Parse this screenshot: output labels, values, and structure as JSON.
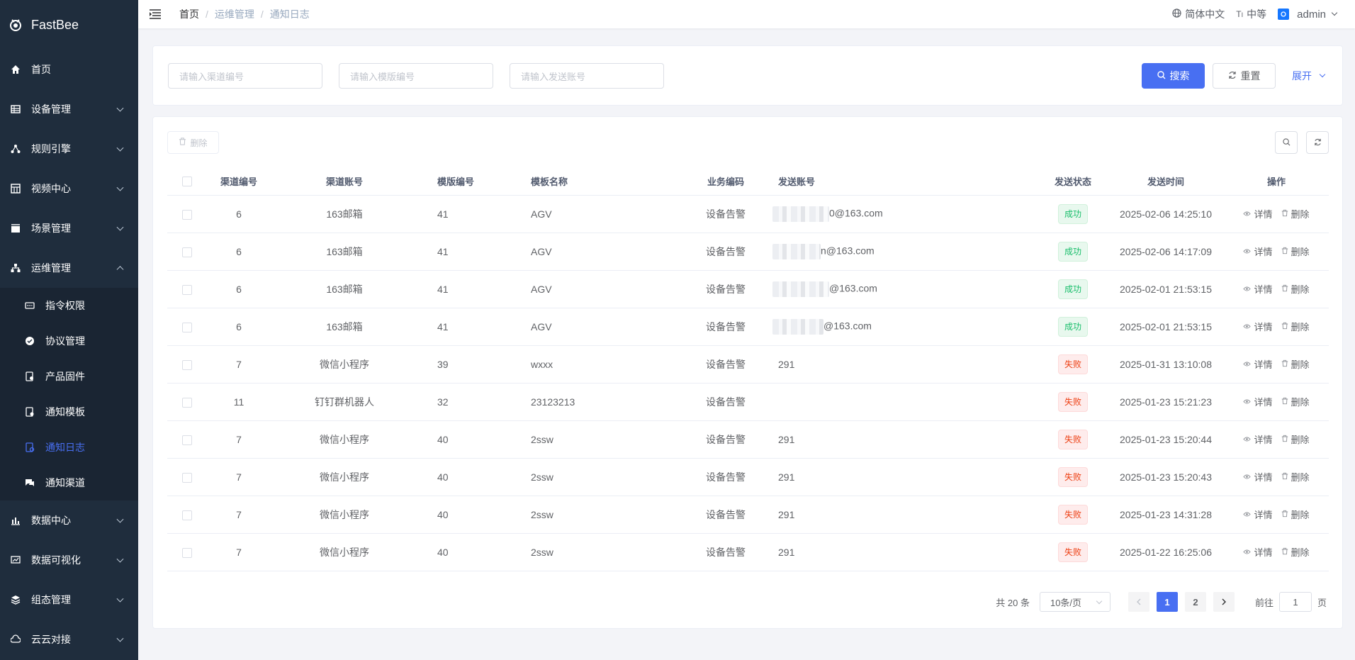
{
  "app": {
    "name": "FastBee"
  },
  "colors": {
    "sidebar_bg": "#1f2d3d",
    "accent": "#486ff2",
    "success": "#19be6b",
    "danger": "#ed4014"
  },
  "sidebar": {
    "items": [
      {
        "label": "首页",
        "icon": "home-icon"
      },
      {
        "label": "设备管理",
        "icon": "device-icon"
      },
      {
        "label": "规则引擎",
        "icon": "rule-icon"
      },
      {
        "label": "视频中心",
        "icon": "video-icon"
      },
      {
        "label": "场景管理",
        "icon": "scene-icon"
      },
      {
        "label": "运维管理",
        "icon": "ops-icon",
        "expanded": true
      },
      {
        "label": "数据中心",
        "icon": "data-center-icon"
      },
      {
        "label": "数据可视化",
        "icon": "visualization-icon"
      },
      {
        "label": "组态管理",
        "icon": "layers-icon"
      },
      {
        "label": "云云对接",
        "icon": "cloud-icon"
      }
    ],
    "ops_children": [
      {
        "label": "指令权限",
        "icon": "command-icon"
      },
      {
        "label": "协议管理",
        "icon": "protocol-icon"
      },
      {
        "label": "产品固件",
        "icon": "firmware-icon"
      },
      {
        "label": "通知模板",
        "icon": "template-icon"
      },
      {
        "label": "通知日志",
        "icon": "log-icon",
        "active": true
      },
      {
        "label": "通知渠道",
        "icon": "channel-icon"
      }
    ]
  },
  "header": {
    "breadcrumb": [
      "首页",
      "运维管理",
      "通知日志"
    ],
    "language": "简体中文",
    "size": "中等",
    "user": "admin"
  },
  "search": {
    "channel_placeholder": "请输入渠道编号",
    "template_placeholder": "请输入模版编号",
    "account_placeholder": "请输入发送账号",
    "search_label": "搜索",
    "reset_label": "重置",
    "expand_label": "展开"
  },
  "toolbar": {
    "delete_label": "删除"
  },
  "table": {
    "columns": [
      "渠道编号",
      "渠道账号",
      "模版编号",
      "模板名称",
      "业务编码",
      "发送账号",
      "发送状态",
      "发送时间",
      "操作"
    ],
    "detail_label": "详情",
    "delete_label": "删除",
    "rows": [
      {
        "channel_id": "6",
        "channel_account": "163邮箱",
        "template_id": "41",
        "template_name": "AGV",
        "biz_code": "设备告警",
        "account": "0@163.com",
        "masked": true,
        "status": "成功",
        "ok": true,
        "time": "2025-02-06 14:25:10"
      },
      {
        "channel_id": "6",
        "channel_account": "163邮箱",
        "template_id": "41",
        "template_name": "AGV",
        "biz_code": "设备告警",
        "account": "n@163.com",
        "masked": true,
        "status": "成功",
        "ok": true,
        "time": "2025-02-06 14:17:09"
      },
      {
        "channel_id": "6",
        "channel_account": "163邮箱",
        "template_id": "41",
        "template_name": "AGV",
        "biz_code": "设备告警",
        "account": "@163.com",
        "masked": true,
        "status": "成功",
        "ok": true,
        "time": "2025-02-01 21:53:15"
      },
      {
        "channel_id": "6",
        "channel_account": "163邮箱",
        "template_id": "41",
        "template_name": "AGV",
        "biz_code": "设备告警",
        "account": "@163.com",
        "masked": true,
        "status": "成功",
        "ok": true,
        "time": "2025-02-01 21:53:15"
      },
      {
        "channel_id": "7",
        "channel_account": "微信小程序",
        "template_id": "39",
        "template_name": "wxxx",
        "biz_code": "设备告警",
        "account": "291",
        "masked": false,
        "status": "失败",
        "ok": false,
        "time": "2025-01-31 13:10:08"
      },
      {
        "channel_id": "11",
        "channel_account": "钉钉群机器人",
        "template_id": "32",
        "template_name": "23123213",
        "biz_code": "设备告警",
        "account": "",
        "masked": false,
        "status": "失败",
        "ok": false,
        "time": "2025-01-23 15:21:23"
      },
      {
        "channel_id": "7",
        "channel_account": "微信小程序",
        "template_id": "40",
        "template_name": "2ssw",
        "biz_code": "设备告警",
        "account": "291",
        "masked": false,
        "status": "失败",
        "ok": false,
        "time": "2025-01-23 15:20:44"
      },
      {
        "channel_id": "7",
        "channel_account": "微信小程序",
        "template_id": "40",
        "template_name": "2ssw",
        "biz_code": "设备告警",
        "account": "291",
        "masked": false,
        "status": "失败",
        "ok": false,
        "time": "2025-01-23 15:20:43"
      },
      {
        "channel_id": "7",
        "channel_account": "微信小程序",
        "template_id": "40",
        "template_name": "2ssw",
        "biz_code": "设备告警",
        "account": "291",
        "masked": false,
        "status": "失败",
        "ok": false,
        "time": "2025-01-23 14:31:28"
      },
      {
        "channel_id": "7",
        "channel_account": "微信小程序",
        "template_id": "40",
        "template_name": "2ssw",
        "biz_code": "设备告警",
        "account": "291",
        "masked": false,
        "status": "失败",
        "ok": false,
        "time": "2025-01-22 16:25:06"
      }
    ]
  },
  "pagination": {
    "total_text": "共 20 条",
    "page_size": "10条/页",
    "pages": [
      "1",
      "2"
    ],
    "current": "1",
    "goto_label": "前往",
    "goto_value": "1",
    "page_suffix": "页"
  }
}
